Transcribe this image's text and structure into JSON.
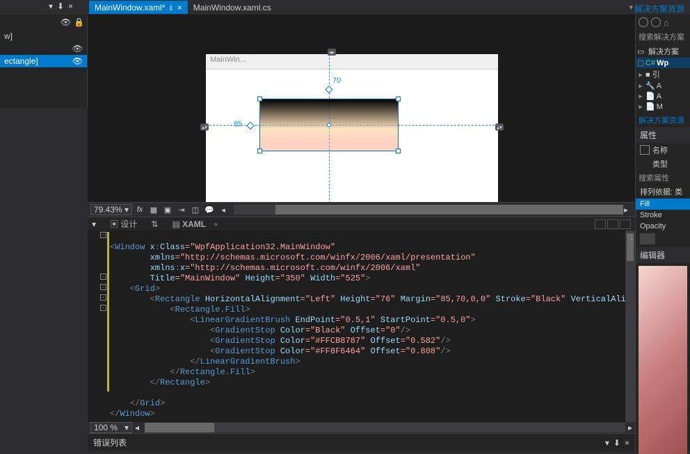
{
  "tabs": {
    "active": "MainWindow.xaml*",
    "inactive": "MainWindow.xaml.cs",
    "pin_glyph": "📌",
    "close_glyph": "×"
  },
  "solution_explorer": {
    "title": "解决方案资源",
    "search": "搜索解决方案",
    "root": "解决方案",
    "project": "Wp",
    "refs": "■ 引",
    "file1": "A",
    "file2": "A",
    "file3": "M",
    "link": "解决方案资源"
  },
  "outline": {
    "item1": "w]",
    "item2": "ectangle]"
  },
  "designer": {
    "window_title": "MainWin...",
    "top_margin": "70",
    "left_margin": "85",
    "zoom": "79.43%"
  },
  "split": {
    "design": "设计",
    "xaml": "XAML"
  },
  "code": {
    "l1_a": "<",
    "l1_b": "Window ",
    "l1_c": "x",
    "l1_d": ":",
    "l1_e": "Class",
    "l1_f": "=\"WpfApplication32.MainWindow\"",
    "l2_a": "xmlns",
    "l2_b": "=\"http://schemas.microsoft.com/winfx/2006/xaml/presentation\"",
    "l3_a": "xmlns",
    "l3_b": ":",
    "l3_c": "x",
    "l3_d": "=\"http://schemas.microsoft.com/winfx/2006/xaml\"",
    "l4_a": "Title",
    "l4_b": "=\"MainWindow\" ",
    "l4_c": "Height",
    "l4_d": "=\"350\" ",
    "l4_e": "Width",
    "l4_f": "=\"525\"",
    "l4_g": ">",
    "l5": "<",
    "l5b": "Grid",
    "l5c": ">",
    "l6_a": "<",
    "l6_b": "Rectangle ",
    "l6_c": "HorizontalAlignment",
    "l6_d": "=\"Left\" ",
    "l6_e": "Height",
    "l6_f": "=\"76\" ",
    "l6_g": "Margin",
    "l6_h": "=\"85,70,0,0\" ",
    "l6_i": "Stroke",
    "l6_j": "=\"Black\" ",
    "l6_k": "VerticalAlign",
    "l7_a": "<",
    "l7_b": "Rectangle.Fill",
    "l7_c": ">",
    "l8_a": "<",
    "l8_b": "LinearGradientBrush ",
    "l8_c": "EndPoint",
    "l8_d": "=\"0.5,1\" ",
    "l8_e": "StartPoint",
    "l8_f": "=\"0.5,0\"",
    "l8_g": ">",
    "l9_a": "<",
    "l9_b": "GradientStop ",
    "l9_c": "Color",
    "l9_d": "=\"Black\" ",
    "l9_e": "Offset",
    "l9_f": "=\"0\"",
    "l9_g": "/>",
    "l10_a": "<",
    "l10_b": "GradientStop ",
    "l10_c": "Color",
    "l10_d": "=\"#FFCB8787\" ",
    "l10_e": "Offset",
    "l10_f": "=\"0.582\"",
    "l10_g": "/>",
    "l11_a": "<",
    "l11_b": "GradientStop ",
    "l11_c": "Color",
    "l11_d": "=\"#FF8F6464\" ",
    "l11_e": "Offset",
    "l11_f": "=\"0.808\"",
    "l11_g": "/>",
    "l12_a": "</",
    "l12_b": "LinearGradientBrush",
    "l12_c": ">",
    "l13_a": "</",
    "l13_b": "Rectangle.Fill",
    "l13_c": ">",
    "l14_a": "</",
    "l14_b": "Rectangle",
    "l14_c": ">",
    "l15_blank": "",
    "l16_a": "</",
    "l16_b": "Grid",
    "l16_c": ">",
    "l17_a": "</",
    "l17_b": "Window",
    "l17_c": ">",
    "zoom": "100 %"
  },
  "error_list": {
    "title": "错误列表"
  },
  "properties": {
    "title": "属性",
    "name_label": "名称",
    "type_label": "类型",
    "search": "搜索属性",
    "arrange": "排列依据: 类",
    "fill": "Fill",
    "stroke": "Stroke",
    "opacity": "Opacity",
    "editor": "编辑器"
  }
}
